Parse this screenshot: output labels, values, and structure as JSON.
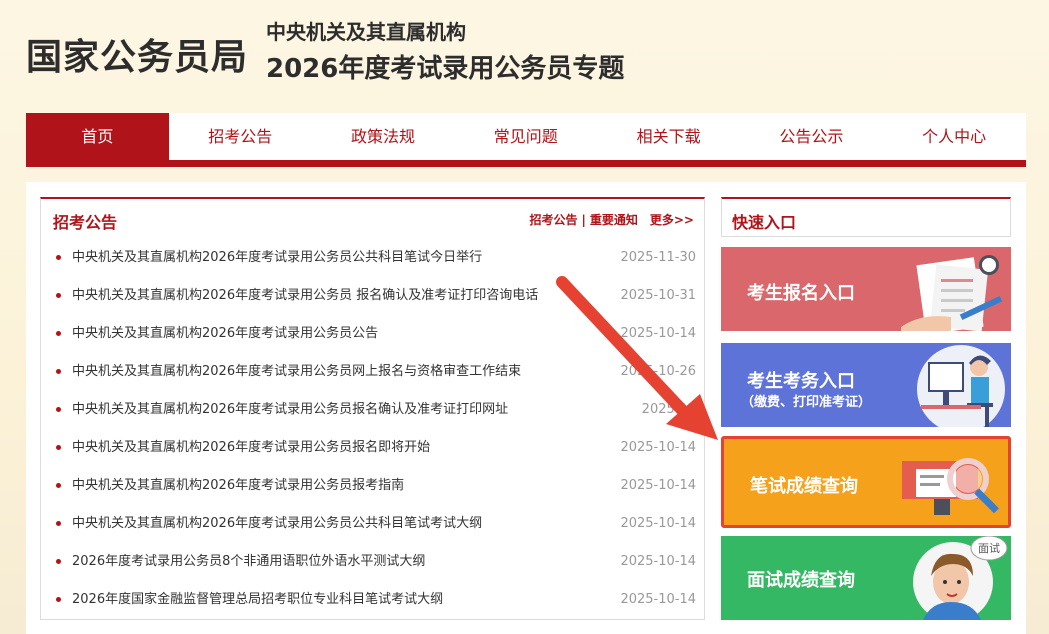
{
  "header": {
    "brand": "国家公务员局",
    "subtitle1": "中央机关及其直属机构",
    "subtitle2": "2026年度考试录用公务员专题"
  },
  "nav": {
    "items": [
      {
        "label": "首页",
        "active": true
      },
      {
        "label": "招考公告",
        "active": false
      },
      {
        "label": "政策法规",
        "active": false
      },
      {
        "label": "常见问题",
        "active": false
      },
      {
        "label": "相关下载",
        "active": false
      },
      {
        "label": "公告公示",
        "active": false
      },
      {
        "label": "个人中心",
        "active": false
      }
    ]
  },
  "notices": {
    "title": "招考公告",
    "links": [
      "招考公告",
      "重要通知"
    ],
    "separator": "|",
    "more": "更多>>",
    "items": [
      {
        "title": "中央机关及其直属机构2026年度考试录用公务员公共科目笔试今日举行",
        "date": "2025-11-30"
      },
      {
        "title": "中央机关及其直属机构2026年度考试录用公务员 报名确认及准考证打印咨询电话",
        "date": "2025-10-31"
      },
      {
        "title": "中央机关及其直属机构2026年度考试录用公务员公告",
        "date": "2025-10-14"
      },
      {
        "title": "中央机关及其直属机构2026年度考试录用公务员网上报名与资格审查工作结束",
        "date": "2025-10-26"
      },
      {
        "title": "中央机关及其直属机构2026年度考试录用公务员报名确认及准考证打印网址",
        "date": "2025-10"
      },
      {
        "title": "中央机关及其直属机构2026年度考试录用公务员报名即将开始",
        "date": "2025-10-14"
      },
      {
        "title": "中央机关及其直属机构2026年度考试录用公务员报考指南",
        "date": "2025-10-14"
      },
      {
        "title": "中央机关及其直属机构2026年度考试录用公务员公共科目笔试考试大纲",
        "date": "2025-10-14"
      },
      {
        "title": "2026年度考试录用公务员8个非通用语职位外语水平测试大纲",
        "date": "2025-10-14"
      },
      {
        "title": "2026年度国家金融监督管理总局招考职位专业科目笔试考试大纲",
        "date": "2025-10-14"
      }
    ]
  },
  "quick": {
    "title": "快速入口",
    "cards": [
      {
        "label": "考生报名入口",
        "sublabel": "",
        "color": "#d9676b"
      },
      {
        "label": "考生考务入口",
        "sublabel": "（缴费、打印准考证）",
        "color": "#5e73d8"
      },
      {
        "label": "笔试成绩查询",
        "sublabel": "",
        "color": "#f6a11b"
      },
      {
        "label": "面试成绩查询",
        "sublabel": "",
        "color": "#35b864"
      }
    ],
    "badge": "面试"
  },
  "colors": {
    "primary_red": "#b0141a",
    "highlight_border": "#e64232",
    "arrow": "#e64232"
  }
}
